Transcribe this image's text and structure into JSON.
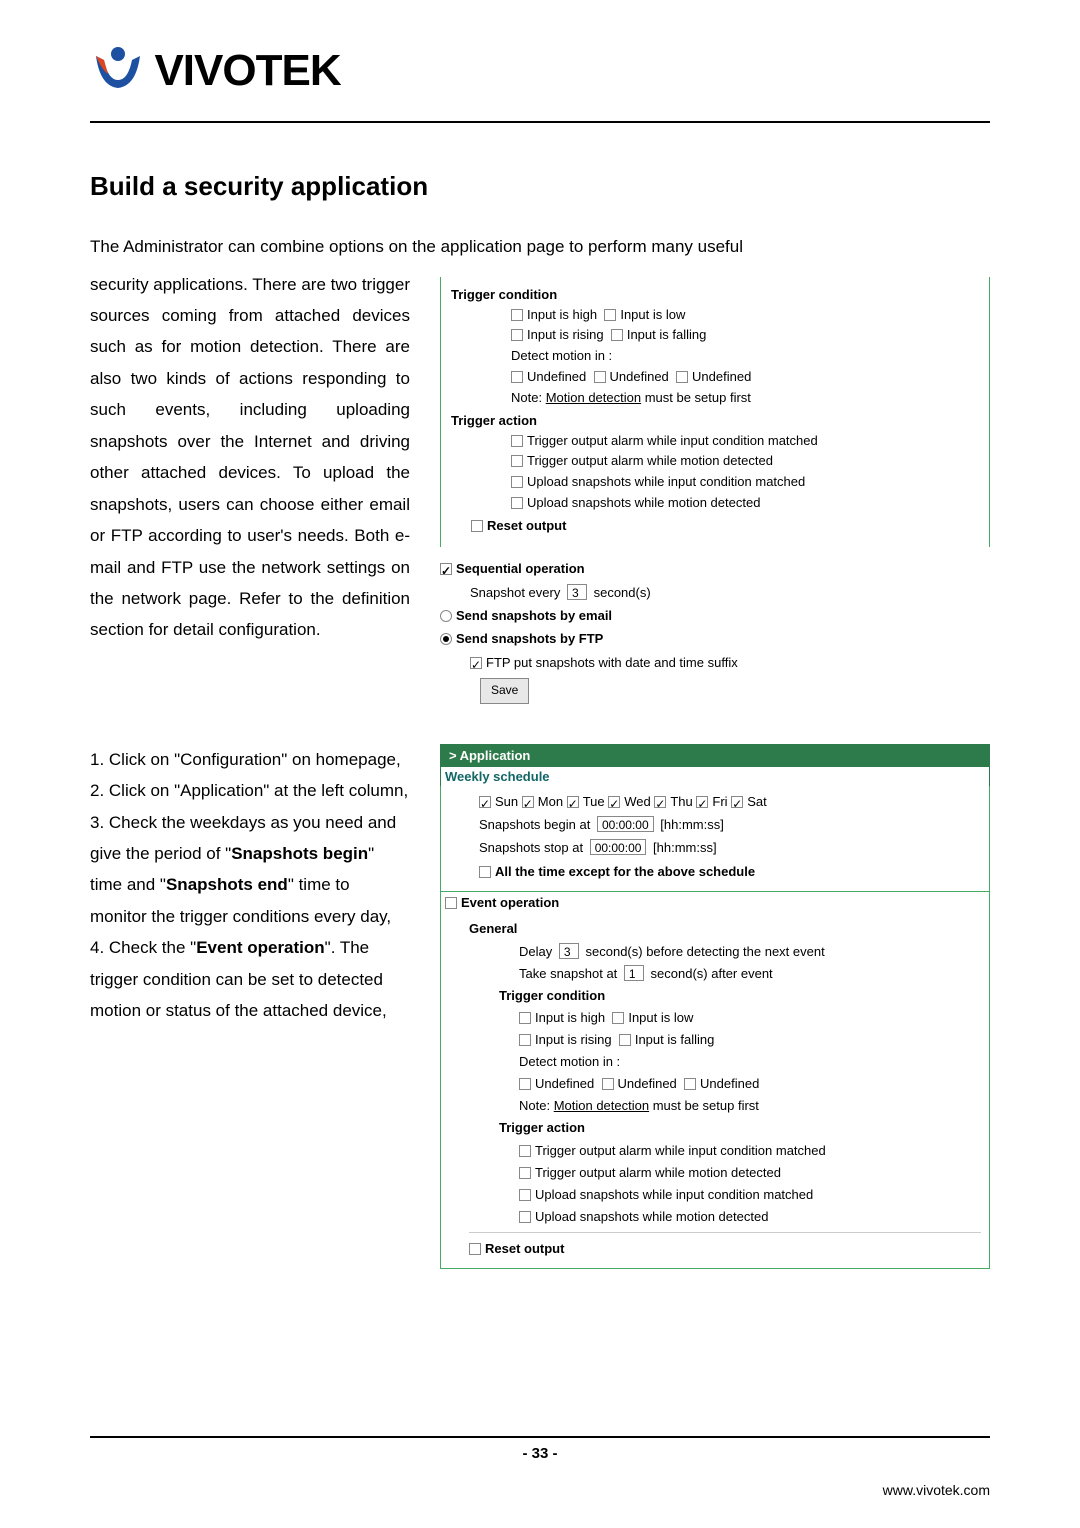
{
  "logo": {
    "brand": "VIVOTEK"
  },
  "title": "Build a security application",
  "intro_full": "The Administrator can combine options on the application page to perform many useful",
  "left_para": "security applications. There are two trigger sources coming from attached devices such as for motion detection. There are also two kinds of actions responding to such events, including uploading snapshots over the Internet and driving other attached devices. To upload the snapshots, users can choose either email or FTP according to user's needs. Both e-mail and FTP use the network settings on the network page. Refer to the definition section for detail configuration.",
  "panel1": {
    "trigger_condition": "Trigger condition",
    "input_high": "Input is high",
    "input_low": "Input is low",
    "input_rising": "Input is rising",
    "input_falling": "Input is falling",
    "detect_motion": "Detect motion in :",
    "undef1": "Undefined",
    "undef2": "Undefined",
    "undef3": "Undefined",
    "note_prefix": "Note: ",
    "note_link": "Motion detection",
    "note_suffix": " must be setup first",
    "trigger_action": "Trigger action",
    "ta1": "Trigger output alarm while input condition matched",
    "ta2": "Trigger output alarm while motion detected",
    "ta3": "Upload snapshots while input condition matched",
    "ta4": "Upload snapshots while motion detected",
    "reset_output": "Reset output",
    "seq_op": "Sequential operation",
    "snapshot_every_prefix": "Snapshot every",
    "snapshot_every_val": "3",
    "snapshot_every_suffix": "second(s)",
    "send_email": "Send snapshots by email",
    "send_ftp": "Send snapshots by FTP",
    "ftp_suffix_label": "FTP put snapshots with date and time suffix",
    "save_btn": "Save"
  },
  "steps": {
    "s1": "1. Click on \"Configuration\" on homepage,",
    "s2": "2. Click on \"Application\" at the left column,",
    "s3a": "3. Check the weekdays as you need and give the period of \"",
    "s3b": "Snapshots begin",
    "s3c": "\" time and \"",
    "s3d": "Snapshots end",
    "s3e": "\" time to monitor the trigger conditions every day,",
    "s4a": "4. Check the \"",
    "s4b": "Event operation",
    "s4c": "\". The trigger condition can be set to detected motion or status of the attached device,"
  },
  "panel2": {
    "app_header": "Application",
    "weekly_header": "Weekly schedule",
    "weekdays": {
      "sun": "Sun",
      "mon": "Mon",
      "tue": "Tue",
      "wed": "Wed",
      "thu": "Thu",
      "fri": "Fri",
      "sat": "Sat"
    },
    "begin_prefix": "Snapshots begin at",
    "begin_val": "00:00:00",
    "time_fmt": "[hh:mm:ss]",
    "stop_prefix": "Snapshots stop at",
    "stop_val": "00:00:00",
    "all_time": "All the time except for the above schedule",
    "event_op": "Event operation",
    "general": "General",
    "delay_prefix": "Delay",
    "delay_val": "3",
    "delay_suffix": "second(s) before detecting the next event",
    "take_prefix": "Take snapshot at",
    "take_val": "1",
    "take_suffix": "second(s) after event",
    "trigger_condition": "Trigger condition",
    "input_high": "Input is high",
    "input_low": "Input is low",
    "input_rising": "Input is rising",
    "input_falling": "Input is falling",
    "detect_motion": "Detect motion in :",
    "undef1": "Undefined",
    "undef2": "Undefined",
    "undef3": "Undefined",
    "note_prefix": "Note: ",
    "note_link": "Motion detection",
    "note_suffix": " must be setup first",
    "trigger_action": "Trigger action",
    "ta1": "Trigger output alarm while input condition matched",
    "ta2": "Trigger output alarm while motion detected",
    "ta3": "Upload snapshots while input condition matched",
    "ta4": "Upload snapshots while motion detected",
    "reset_output": "Reset output"
  },
  "page_number": "- 33 -",
  "footer_url": "www.vivotek.com"
}
